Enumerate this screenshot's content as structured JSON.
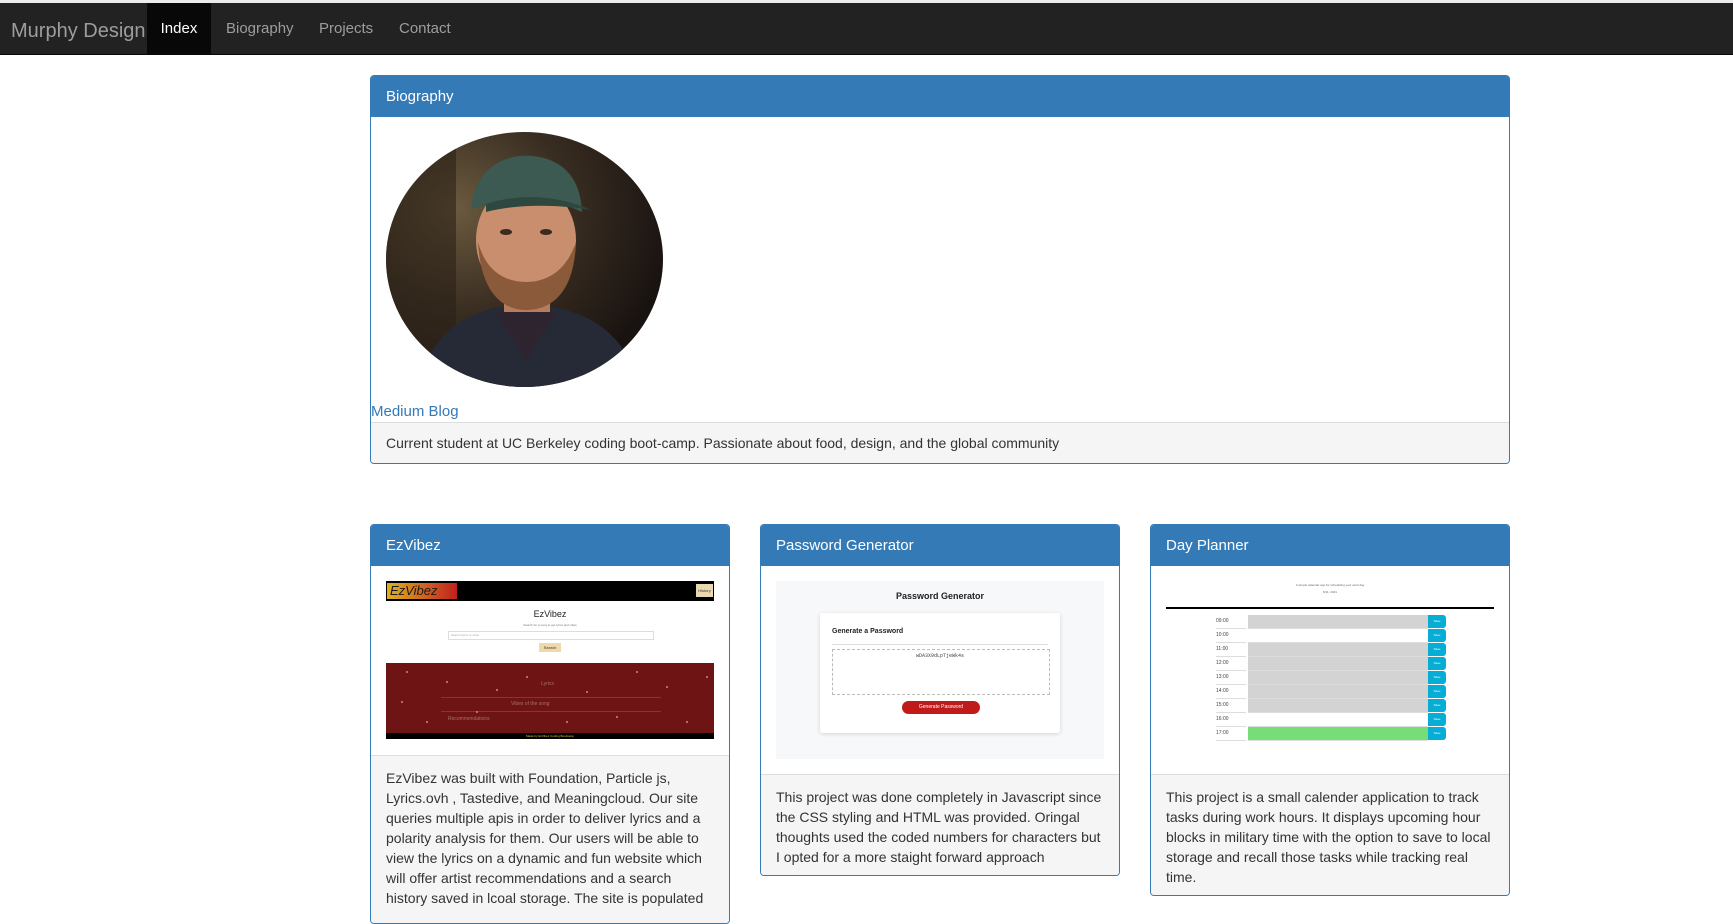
{
  "navbar": {
    "brand": "Murphy Design",
    "items": [
      {
        "label": "Index",
        "active": true
      },
      {
        "label": "Biography",
        "active": false
      },
      {
        "label": "Projects",
        "active": false
      },
      {
        "label": "Contact",
        "active": false
      }
    ]
  },
  "biography": {
    "heading": "Biography",
    "link": "Medium Blog",
    "footer": "Current student at UC Berkeley coding boot-camp. Passionate about food, design, and the global community"
  },
  "projects": [
    {
      "heading": "EzVibez",
      "shot": {
        "logo": "EzVibez",
        "title": "EzVibez",
        "subtitle": "Search for a song to get lyrics and vibes",
        "placeholder": "Search lyrics or artist",
        "button": "Search",
        "history_button": "History",
        "rows": [
          "Lyrics",
          "Vibes of the song",
          "Recommendations"
        ],
        "footer": "Made by EzVibez Coding Bootcamp"
      },
      "description": "EzVibez was built with Foundation, Particle js, Lyrics.ovh , Tastedive, and Meaningcloud. Our site queries multiple apis in order to deliver lyrics and a polarity analysis for them. Our users will be able to view the lyrics on a dynamic and fun website which will offer artist recommendations and a search history saved in lcoal storage. The site is populated"
    },
    {
      "heading": "Password Generator",
      "shot": {
        "title": "Password Generator",
        "card_title": "Generate a Password",
        "password": "wDA3X9dLpTjeWk4s",
        "button": "Generate Password"
      },
      "description": "This project was done completely in Javascript since the CSS styling and HTML was provided. Oringal thoughts used the coded numbers for characters but I opted for a more staight forward approach"
    },
    {
      "heading": "Day Planner",
      "shot": {
        "subtitle": "A simple calendar app for scheduling your work day",
        "date": "5/11, 2021",
        "hours": [
          "09:00",
          "10:00",
          "11:00",
          "12:00",
          "13:00",
          "14:00",
          "15:00",
          "16:00",
          "17:00"
        ],
        "save": "Save"
      },
      "description": "This project is a small calender application to track tasks during work hours. It displays upcoming hour blocks in military time with the option to save to local storage and recall those tasks while tracking real time."
    }
  ]
}
